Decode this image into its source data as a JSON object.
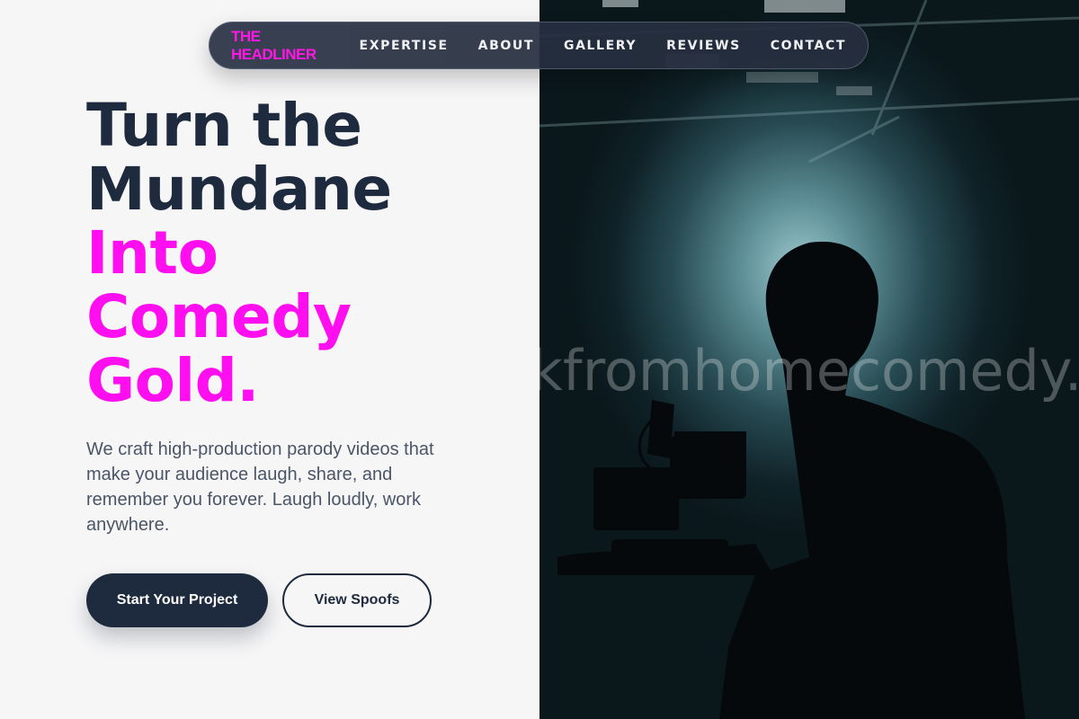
{
  "nav": {
    "brand": "THE HEADLINER",
    "links": [
      "EXPERTISE",
      "ABOUT",
      "GALLERY",
      "REVIEWS",
      "CONTACT"
    ]
  },
  "hero": {
    "headline_dark": [
      "Turn the",
      "Mundane"
    ],
    "headline_pink": [
      "Into",
      "Comedy",
      "Gold."
    ],
    "description": "We craft high-production parody videos that make your audience laugh, share, and remember you forever. Laugh loudly, work anywhere.",
    "primary_button": "Start Your Project",
    "secondary_button": "View Spoofs"
  },
  "image": {
    "watermark": "kfromhomecomedy.c"
  },
  "colors": {
    "accent": "#ff0ff0",
    "navy": "#1e2a3d",
    "background": "#f6f6f7"
  }
}
